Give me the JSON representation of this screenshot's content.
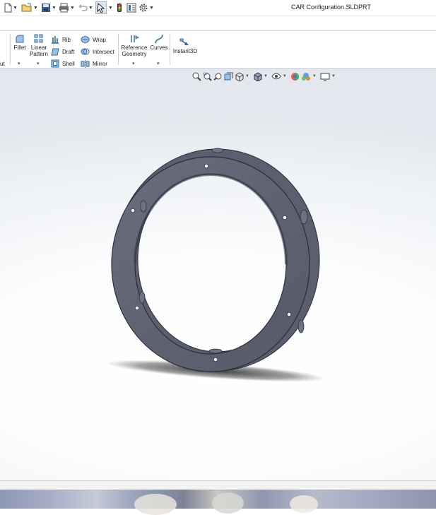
{
  "window": {
    "title": "CAR Configuration.SLDPRT"
  },
  "quick_access": {
    "items": [
      {
        "icon": "new-document-icon"
      },
      {
        "icon": "open-folder-icon"
      },
      {
        "icon": "save-icon"
      },
      {
        "icon": "print-icon"
      },
      {
        "icon": "undo-icon"
      },
      {
        "icon": "select-pointer-icon"
      },
      {
        "icon": "rebuild-icon"
      },
      {
        "icon": "file-properties-icon"
      },
      {
        "icon": "options-gear-icon"
      }
    ]
  },
  "ribbon": {
    "cut_group_label": "ut",
    "fillet": "Fillet",
    "linear_pattern_line1": "Linear",
    "linear_pattern_line2": "Pattern",
    "rib": "Rib",
    "draft": "Draft",
    "shell": "Shell",
    "wrap": "Wrap",
    "intersect": "Intersect",
    "mirror": "Mirror",
    "reference_geometry_line1": "Reference",
    "reference_geometry_line2": "Geometry",
    "curves": "Curves",
    "instant3d": "Instant3D"
  },
  "heads_up_toolbar": {
    "items": [
      "zoom-to-fit-icon",
      "zoom-to-area-icon",
      "previous-view-icon",
      "section-view-icon",
      "view-orientation-icon",
      "display-style-icon",
      "hide-show-items-icon",
      "edit-appearance-icon",
      "apply-scene-icon",
      "view-settings-icon"
    ]
  },
  "model": {
    "name": "ring-part",
    "color": "#5f6273",
    "holes": 8
  },
  "colors": {
    "accent": "#1f6fc1",
    "model_face": "#5f6273",
    "model_edge": "#2b2d36"
  }
}
